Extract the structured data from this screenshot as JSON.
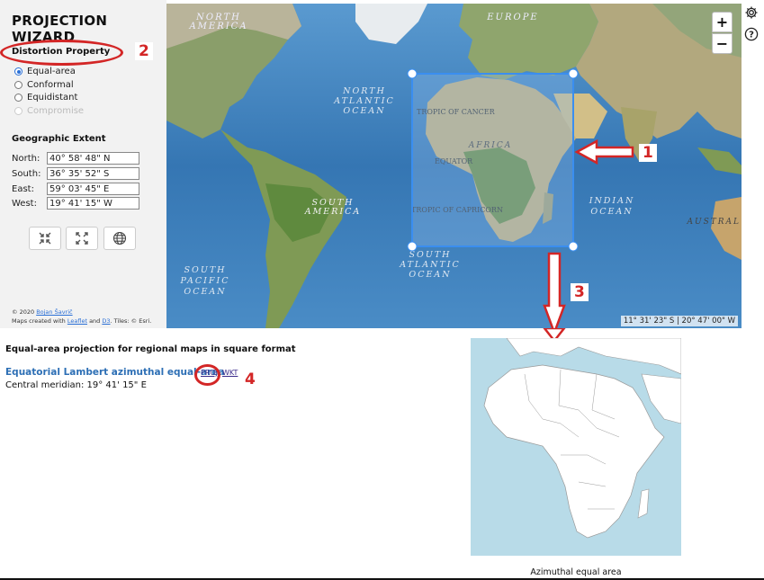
{
  "app": {
    "title": "PROJECTION WIZARD"
  },
  "distortion": {
    "title": "Distortion Property",
    "options": [
      {
        "label": "Equal-area",
        "selected": true,
        "disabled": false
      },
      {
        "label": "Conformal",
        "selected": false,
        "disabled": false
      },
      {
        "label": "Equidistant",
        "selected": false,
        "disabled": false
      },
      {
        "label": "Compromise",
        "selected": false,
        "disabled": true
      }
    ]
  },
  "extent": {
    "title": "Geographic Extent",
    "rows": [
      {
        "label": "North:",
        "value": "40° 58' 48\" N"
      },
      {
        "label": "South:",
        "value": "36° 35' 52\" S"
      },
      {
        "label": "East:",
        "value": "59° 03' 45\" E"
      },
      {
        "label": "West:",
        "value": "19° 41' 15\" W"
      }
    ]
  },
  "tools": {
    "icons": [
      "collapse-icon",
      "expand-icon",
      "globe-icon"
    ]
  },
  "credits": {
    "line1_prefix": "© 2020 ",
    "author": "Bojan Šavrič",
    "line2_prefix": "Maps created with ",
    "leaflet": "Leaflet",
    "and": " and ",
    "d3": "D3",
    "tiles": ". Tiles: © Esri."
  },
  "map": {
    "zoom_in": "+",
    "zoom_out": "−",
    "coord_readout": "11° 31' 23\" S | 20° 47' 00\" W",
    "labels": {
      "north_america": [
        "NORTH",
        "AMERICA"
      ],
      "europe": "EUROPE",
      "north_atlantic": [
        "NORTH",
        "ATLANTIC",
        "OCEAN"
      ],
      "tropic_cancer": "TROPIC OF CANCER",
      "africa": "AFRICA",
      "equator": "EQUATOR",
      "tropic_capricorn": "TROPIC OF CAPRICORN",
      "south_america": [
        "SOUTH",
        "AMERICA"
      ],
      "south_atlantic": [
        "SOUTH",
        "ATLANTIC",
        "OCEAN"
      ],
      "south_pacific": [
        "SOUTH",
        "PACIFIC",
        "OCEAN"
      ],
      "indian_ocean": [
        "INDIAN",
        "OCEAN"
      ],
      "australia": "AUSTRAL"
    }
  },
  "side_tools": {
    "icons": [
      "gear-icon",
      "help-icon"
    ]
  },
  "annotations": {
    "n1": "1",
    "n2": "2",
    "n3": "3",
    "n4": "4"
  },
  "result": {
    "heading": "Equal-area projection for regional maps in square format",
    "projection_name": "Equatorial Lambert azimuthal equal-area",
    "proj_link": "PROJ",
    "wkt_link": "WKT",
    "central_meridian": "Central meridian: 19° 41' 15\" E",
    "preview_caption": "Azimuthal equal area"
  },
  "colors": {
    "accent": "#2a6fd6",
    "annotation_red": "#d32626",
    "selection_box": "#3a8ef0",
    "ocean": "#3c7fb8",
    "land": "#7f9a5a",
    "preview_ocean": "#b8dbe8",
    "preview_land": "#ffffff"
  }
}
